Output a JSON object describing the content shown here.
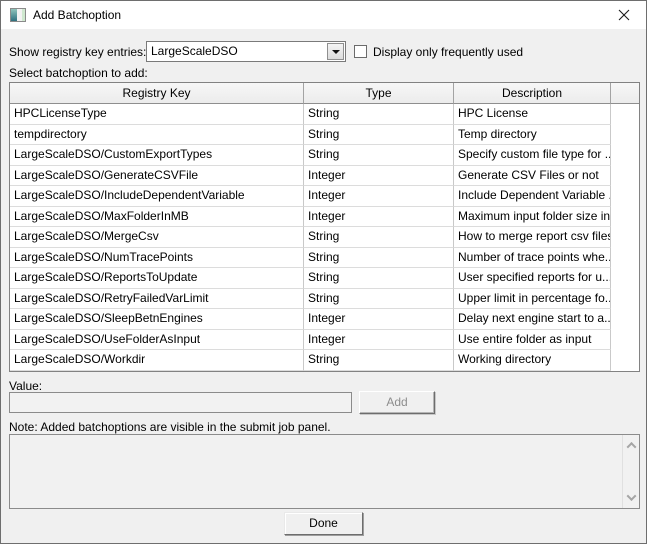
{
  "window": {
    "title": "Add Batchoption"
  },
  "filters": {
    "registry_label": "Show registry key entries:",
    "registry_selected": "LargeScaleDSO",
    "frequent_checkbox_label": "Display only frequently used",
    "frequent_checked": "false"
  },
  "table": {
    "section_label": "Select batchoption to add:",
    "columns": [
      "Registry Key",
      "Type",
      "Description"
    ],
    "rows": [
      {
        "key": "HPCLicenseType",
        "type": "String",
        "description": "HPC License"
      },
      {
        "key": "tempdirectory",
        "type": "String",
        "description": "Temp directory"
      },
      {
        "key": "LargeScaleDSO/CustomExportTypes",
        "type": "String",
        "description": "Specify custom file type for ..."
      },
      {
        "key": "LargeScaleDSO/GenerateCSVFile",
        "type": "Integer",
        "description": "Generate CSV Files or not"
      },
      {
        "key": "LargeScaleDSO/IncludeDependentVariable",
        "type": "Integer",
        "description": "Include Dependent Variable ..."
      },
      {
        "key": "LargeScaleDSO/MaxFolderInMB",
        "type": "Integer",
        "description": "Maximum input folder size in..."
      },
      {
        "key": "LargeScaleDSO/MergeCsv",
        "type": "String",
        "description": "How to merge report csv files"
      },
      {
        "key": "LargeScaleDSO/NumTracePoints",
        "type": "String",
        "description": "Number of trace points whe..."
      },
      {
        "key": "LargeScaleDSO/ReportsToUpdate",
        "type": "String",
        "description": "User specified reports for u..."
      },
      {
        "key": "LargeScaleDSO/RetryFailedVarLimit",
        "type": "String",
        "description": "Upper limit in percentage fo..."
      },
      {
        "key": "LargeScaleDSO/SleepBetnEngines",
        "type": "Integer",
        "description": "Delay next engine start to a..."
      },
      {
        "key": "LargeScaleDSO/UseFolderAsInput",
        "type": "Integer",
        "description": "Use entire folder as input"
      },
      {
        "key": "LargeScaleDSO/Workdir",
        "type": "String",
        "description": "Working directory"
      }
    ]
  },
  "value_section": {
    "label": "Value:",
    "input_value": "",
    "add_button_label": "Add",
    "add_button_enabled": "false"
  },
  "note": "Note: Added batchoptions are visible in the submit job panel.",
  "footer": {
    "done_button_label": "Done"
  },
  "colors": {
    "titlebar_bg": "#ffffff",
    "dialog_bg": "#f0f0f0",
    "disabled_text": "#8d8d8d",
    "icon_teal": "#2e6f7e"
  }
}
